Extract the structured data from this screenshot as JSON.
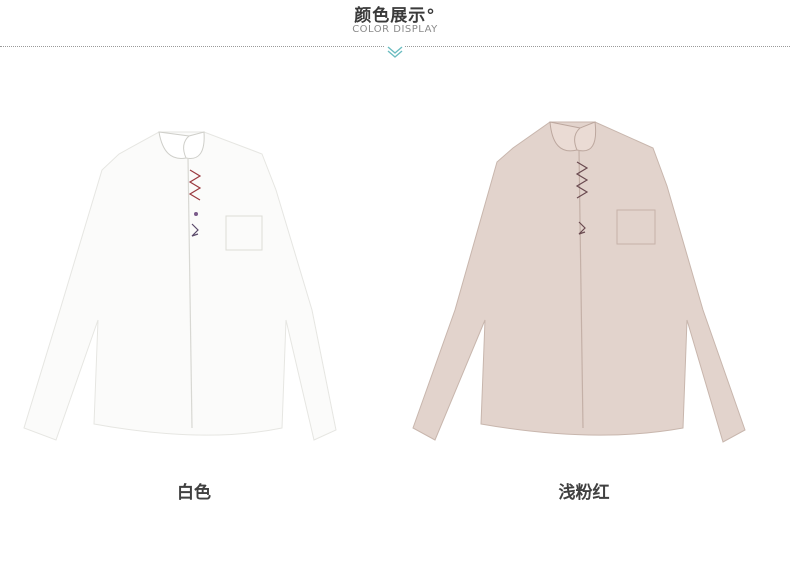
{
  "header": {
    "title": "颜色展示°",
    "subtitle": "COLOR DISPLAY"
  },
  "colors": [
    {
      "label": "白色",
      "swatch": "#fbfbfa",
      "shade": "#e6e6e2",
      "icon": "white-shirt-icon"
    },
    {
      "label": "浅粉红",
      "swatch": "#e2d3cc",
      "shade": "#c8b6ad",
      "icon": "pink-shirt-icon"
    }
  ],
  "accent": "#6bbcc0"
}
